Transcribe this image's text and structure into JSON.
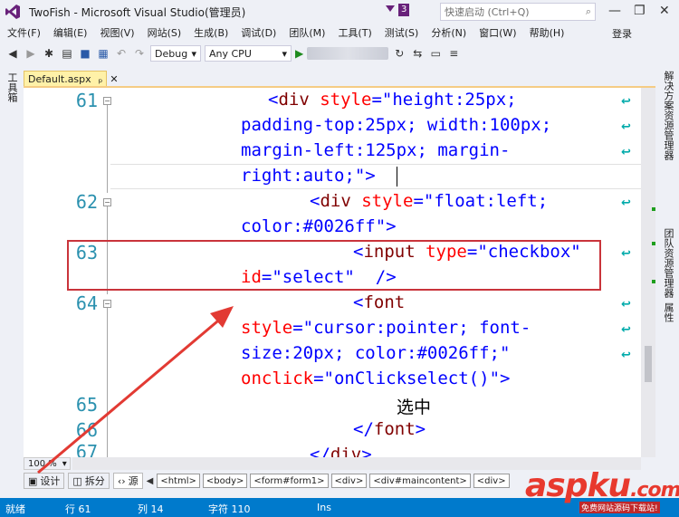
{
  "window": {
    "title": "TwoFish - Microsoft Visual Studio(管理员)",
    "notification_count": "3",
    "quick_launch_placeholder": "快速启动 (Ctrl+Q)",
    "controls": {
      "minimize": "—",
      "restore": "❐",
      "close": "✕"
    }
  },
  "menu": {
    "items": [
      "文件(F)",
      "编辑(E)",
      "视图(V)",
      "网站(S)",
      "生成(B)",
      "调试(D)",
      "团队(M)",
      "工具(T)",
      "测试(S)",
      "分析(N)",
      "窗口(W)",
      "帮助(H)"
    ],
    "login": "登录"
  },
  "toolbar": {
    "configuration": "Debug",
    "platform": "Any CPU"
  },
  "left_strip": {
    "label": "工具箱"
  },
  "right_strip": {
    "labels": [
      "解决方案资源管理器",
      "团队资源管理器",
      "属性"
    ]
  },
  "tab": {
    "label": "Default.aspx",
    "pin": "ₚ",
    "close": "✕"
  },
  "editor": {
    "line_numbers": [
      "61",
      "62",
      "63",
      "64",
      "65",
      "66",
      "67"
    ],
    "code_lines": [
      {
        "parts": [
          [
            "br",
            "<"
          ],
          [
            "tag",
            "div"
          ],
          [
            "txt",
            " "
          ],
          [
            "attr",
            "style"
          ],
          [
            "br",
            "=\""
          ],
          [
            "val",
            "height:25px;"
          ]
        ]
      },
      {
        "parts": [
          [
            "val",
            "padding-top:25px; width:100px;"
          ]
        ]
      },
      {
        "parts": [
          [
            "val",
            "margin-left:125px; margin-"
          ]
        ]
      },
      {
        "parts": [
          [
            "val",
            "right:auto;"
          ],
          [
            "br",
            "\">"
          ]
        ]
      },
      {
        "parts": [
          [
            "br",
            "<"
          ],
          [
            "tag",
            "div"
          ],
          [
            "txt",
            " "
          ],
          [
            "attr",
            "style"
          ],
          [
            "br",
            "=\""
          ],
          [
            "val",
            "float:left;"
          ]
        ]
      },
      {
        "parts": [
          [
            "val",
            "color:#0026ff"
          ],
          [
            "br",
            "\">"
          ]
        ]
      },
      {
        "parts": [
          [
            "br",
            "<"
          ],
          [
            "tag",
            "input"
          ],
          [
            "txt",
            " "
          ],
          [
            "attr",
            "type"
          ],
          [
            "br",
            "=\""
          ],
          [
            "val",
            "checkbox"
          ],
          [
            "br",
            "\""
          ]
        ]
      },
      {
        "parts": [
          [
            "attr",
            "id"
          ],
          [
            "br",
            "=\""
          ],
          [
            "val",
            "select"
          ],
          [
            "br",
            "\""
          ],
          [
            "txt",
            "  "
          ],
          [
            "br",
            "/>"
          ]
        ]
      },
      {
        "parts": [
          [
            "br",
            "<"
          ],
          [
            "tag",
            "font"
          ]
        ]
      },
      {
        "parts": [
          [
            "attr",
            "style"
          ],
          [
            "br",
            "=\""
          ],
          [
            "val",
            "cursor:pointer; font-"
          ]
        ]
      },
      {
        "parts": [
          [
            "val",
            "size:20px; color:#0026ff;"
          ],
          [
            "br",
            "\""
          ]
        ]
      },
      {
        "parts": [
          [
            "attr",
            "onclick"
          ],
          [
            "br",
            "=\""
          ],
          [
            "val",
            "onClickselect()"
          ],
          [
            "br",
            "\">"
          ]
        ]
      },
      {
        "parts": [
          [
            "txt",
            "选中"
          ]
        ]
      },
      {
        "parts": [
          [
            "br",
            "</"
          ],
          [
            "tag",
            "font"
          ],
          [
            "br",
            ">"
          ]
        ]
      },
      {
        "parts": [
          [
            "br",
            "</"
          ],
          [
            "tag",
            "div"
          ],
          [
            "br",
            ">"
          ]
        ]
      }
    ]
  },
  "zoom": {
    "value": "100 %"
  },
  "viewbar": {
    "design": "设计",
    "split": "拆分",
    "source": "源",
    "breadcrumbs": [
      "<html>",
      "<body>",
      "<form#form1>",
      "<div>",
      "<div#maincontent>",
      "<div>"
    ]
  },
  "status": {
    "ready": "就绪",
    "line": "行 61",
    "col": "列 14",
    "char": "字符 110",
    "mode": "Ins"
  },
  "watermark": {
    "brand": "aspku",
    "tld": ".com",
    "sub": "免费网站源码下载站!"
  }
}
